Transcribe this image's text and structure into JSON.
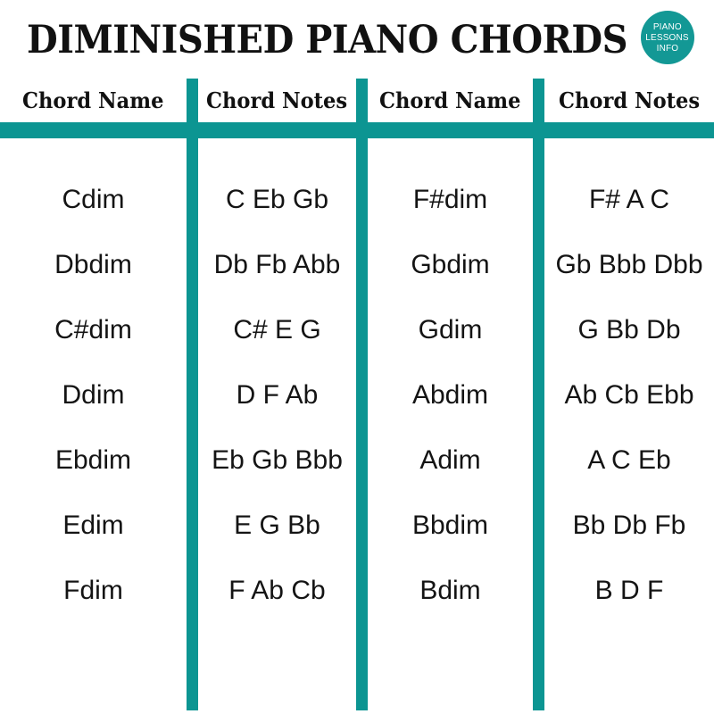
{
  "page": {
    "title": "DIMINISHED PIANO CHORDS",
    "background_color": "#ffffff",
    "accent_color": "#0C9592",
    "text_color": "#141414"
  },
  "logo": {
    "name": "piano-lessons-info-badge",
    "shape": "circle",
    "background_color": "#139895",
    "text_color": "#ffffff",
    "lines": [
      "PIANO",
      "LESSONS",
      "INFO"
    ]
  },
  "table": {
    "headers": [
      "Chord Name",
      "Chord Notes",
      "Chord Name",
      "Chord Notes"
    ],
    "rows": [
      [
        "Cdim",
        "C Eb Gb",
        "F#dim",
        "F# A C"
      ],
      [
        "Dbdim",
        "Db Fb Abb",
        "Gbdim",
        "Gb Bbb Dbb"
      ],
      [
        "C#dim",
        "C# E G",
        "Gdim",
        "G Bb Db"
      ],
      [
        "Ddim",
        "D F Ab",
        "Abdim",
        "Ab Cb Ebb"
      ],
      [
        "Ebdim",
        "Eb Gb Bbb",
        "Adim",
        "A C Eb"
      ],
      [
        "Edim",
        "E G Bb",
        "Bbdim",
        "Bb Db Fb"
      ],
      [
        "Fdim",
        "F Ab Cb",
        "Bdim",
        "B D F"
      ]
    ]
  }
}
